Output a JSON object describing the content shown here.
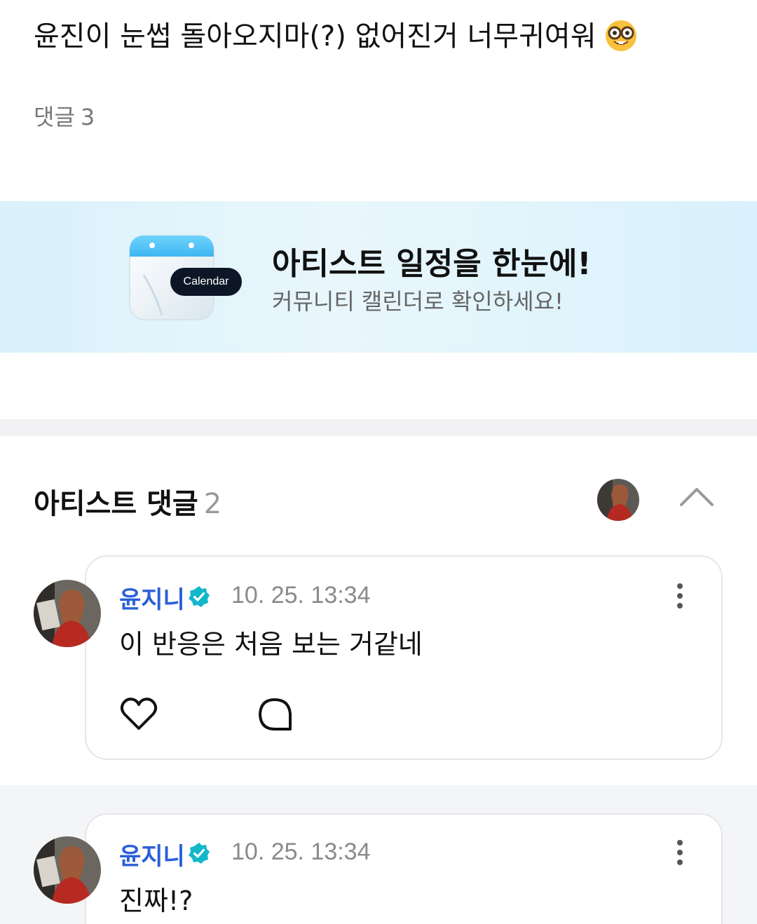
{
  "post": {
    "text": "윤진이 눈썹 돌아오지마(?) 없어진거 너무귀여워",
    "emoji": "nerd-face-emoji"
  },
  "comments_summary": {
    "label": "댓글",
    "count": "3"
  },
  "banner": {
    "badge": "Calendar",
    "title": "아티스트 일정을 한눈에!",
    "subtitle": "커뮤니티 캘린더로 확인하세요!"
  },
  "artist_section": {
    "label": "아티스트 댓글",
    "count": "2"
  },
  "comments": [
    {
      "author": "윤지니",
      "time": "10. 25. 13:34",
      "text": "이 반응은 처음 보는 거같네"
    },
    {
      "author": "윤지니",
      "time": "10. 25. 13:34",
      "text": "진짜!?"
    }
  ],
  "colors": {
    "author_blue": "#2a5fd8",
    "verified_teal": "#12b7c9",
    "banner_bg": "#e3f4fb"
  }
}
